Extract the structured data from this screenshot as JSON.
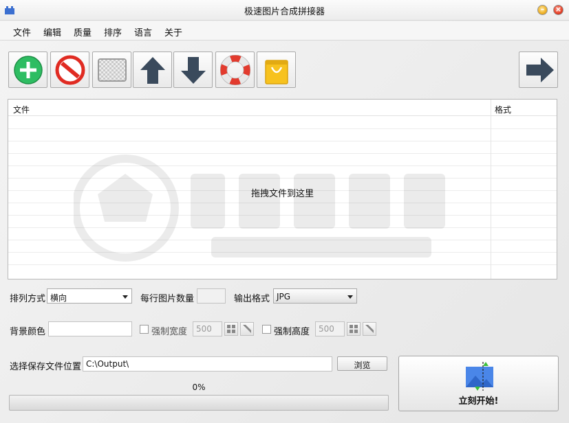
{
  "window": {
    "title": "极速图片合成拼接器"
  },
  "menu": [
    "文件",
    "编辑",
    "质量",
    "排序",
    "语言",
    "关于"
  ],
  "toolbar": {
    "add": "add-icon",
    "remove": "no-entry-icon",
    "clear": "transparent-checker-icon",
    "move_up": "arrow-up-icon",
    "move_down": "arrow-down-icon",
    "help": "lifebuoy-icon",
    "shop": "shopping-bag-icon",
    "next": "arrow-right-icon"
  },
  "file_list": {
    "headers": {
      "file": "文件",
      "format": "格式"
    },
    "drop_hint": "拖拽文件到这里",
    "rows": []
  },
  "settings": {
    "arrangement": {
      "label": "排列方式",
      "value": "横向"
    },
    "per_row": {
      "label": "每行图片数量",
      "value": ""
    },
    "output_format": {
      "label": "输出格式",
      "value": "JPG"
    },
    "background_color": {
      "label": "背景颜色",
      "value": ""
    },
    "force_width": {
      "label": "强制宽度",
      "checked": false,
      "value": "500"
    },
    "force_height": {
      "label": "强制高度",
      "checked": false,
      "value": "500"
    },
    "save_location": {
      "label": "选择保存文件位置",
      "value": "C:\\Output\\",
      "browse": "浏览"
    }
  },
  "progress": {
    "text": "0%",
    "value": 0
  },
  "start": {
    "label": "立刻开始!"
  }
}
